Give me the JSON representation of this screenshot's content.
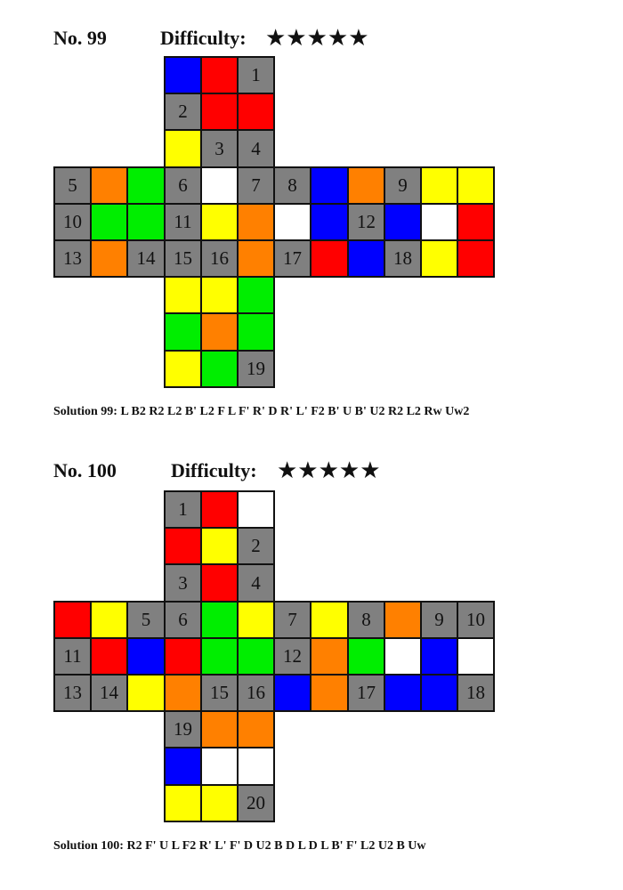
{
  "colors": {
    "Y": "#ffff00",
    "R": "#ff0000",
    "B": "#0000ff",
    "G": "#00ee00",
    "O": "#ff8000",
    "W": "#ffffff",
    "X": "#808080"
  },
  "puzzles": [
    {
      "title": "No. 99",
      "difficulty_label": "Difficulty:",
      "stars": "★★★★★",
      "solution": "Solution 99: L B2 R2 L2 B' L2 F L F' R' D R' L' F2 B' U B' U2 R2 L2 Rw Uw2",
      "rows": [
        [
          null,
          null,
          null,
          "B",
          "R",
          {
            "c": "X",
            "n": "1"
          },
          null,
          null,
          null,
          null,
          null,
          null
        ],
        [
          null,
          null,
          null,
          {
            "c": "X",
            "n": "2"
          },
          "R",
          "R",
          null,
          null,
          null,
          null,
          null,
          null
        ],
        [
          null,
          null,
          null,
          "Y",
          {
            "c": "X",
            "n": "3"
          },
          {
            "c": "X",
            "n": "4"
          },
          null,
          null,
          null,
          null,
          null,
          null
        ],
        [
          {
            "c": "X",
            "n": "5"
          },
          "O",
          "G",
          {
            "c": "X",
            "n": "6"
          },
          "W",
          {
            "c": "X",
            "n": "7"
          },
          {
            "c": "X",
            "n": "8"
          },
          "B",
          "O",
          {
            "c": "X",
            "n": "9"
          },
          "Y",
          "Y"
        ],
        [
          {
            "c": "X",
            "n": "10"
          },
          "G",
          "G",
          {
            "c": "X",
            "n": "11"
          },
          "Y",
          "O",
          "W",
          "B",
          {
            "c": "X",
            "n": "12"
          },
          "B",
          "W",
          "R"
        ],
        [
          {
            "c": "X",
            "n": "13"
          },
          "O",
          {
            "c": "X",
            "n": "14"
          },
          {
            "c": "X",
            "n": "15"
          },
          {
            "c": "X",
            "n": "16"
          },
          "O",
          {
            "c": "X",
            "n": "17"
          },
          "R",
          "B",
          {
            "c": "X",
            "n": "18"
          },
          "Y",
          "R"
        ],
        [
          null,
          null,
          null,
          "Y",
          "Y",
          "G",
          null,
          null,
          null,
          null,
          null,
          null
        ],
        [
          null,
          null,
          null,
          "G",
          "O",
          "G",
          null,
          null,
          null,
          null,
          null,
          null
        ],
        [
          null,
          null,
          null,
          "Y",
          "G",
          {
            "c": "X",
            "n": "19"
          },
          null,
          null,
          null,
          null,
          null,
          null
        ]
      ]
    },
    {
      "title": "No. 100",
      "difficulty_label": "Difficulty:",
      "stars": "★★★★★",
      "solution": "Solution 100: R2 F' U L F2 R' L' F' D U2 B D L D L B' F' L2 U2 B Uw",
      "rows": [
        [
          null,
          null,
          null,
          {
            "c": "X",
            "n": "1"
          },
          "R",
          "W",
          null,
          null,
          null,
          null,
          null,
          null
        ],
        [
          null,
          null,
          null,
          "R",
          "Y",
          {
            "c": "X",
            "n": "2"
          },
          null,
          null,
          null,
          null,
          null,
          null
        ],
        [
          null,
          null,
          null,
          {
            "c": "X",
            "n": "3"
          },
          "R",
          {
            "c": "X",
            "n": "4"
          },
          null,
          null,
          null,
          null,
          null,
          null
        ],
        [
          "R",
          "Y",
          {
            "c": "X",
            "n": "5"
          },
          {
            "c": "X",
            "n": "6"
          },
          "G",
          "Y",
          {
            "c": "X",
            "n": "7"
          },
          "Y",
          {
            "c": "X",
            "n": "8"
          },
          "O",
          {
            "c": "X",
            "n": "9"
          },
          {
            "c": "X",
            "n": "10"
          }
        ],
        [
          {
            "c": "X",
            "n": "11"
          },
          "R",
          "B",
          "R",
          "G",
          "G",
          {
            "c": "X",
            "n": "12"
          },
          "O",
          "G",
          "W",
          "B",
          "W"
        ],
        [
          {
            "c": "X",
            "n": "13"
          },
          {
            "c": "X",
            "n": "14"
          },
          "Y",
          "O",
          {
            "c": "X",
            "n": "15"
          },
          {
            "c": "X",
            "n": "16"
          },
          "B",
          "O",
          {
            "c": "X",
            "n": "17"
          },
          "B",
          "B",
          {
            "c": "X",
            "n": "18"
          }
        ],
        [
          null,
          null,
          null,
          {
            "c": "X",
            "n": "19"
          },
          "O",
          "O",
          null,
          null,
          null,
          null,
          null,
          null
        ],
        [
          null,
          null,
          null,
          "B",
          "W",
          "W",
          null,
          null,
          null,
          null,
          null,
          null
        ],
        [
          null,
          null,
          null,
          "Y",
          "Y",
          {
            "c": "X",
            "n": "20"
          },
          null,
          null,
          null,
          null,
          null,
          null
        ]
      ]
    }
  ]
}
